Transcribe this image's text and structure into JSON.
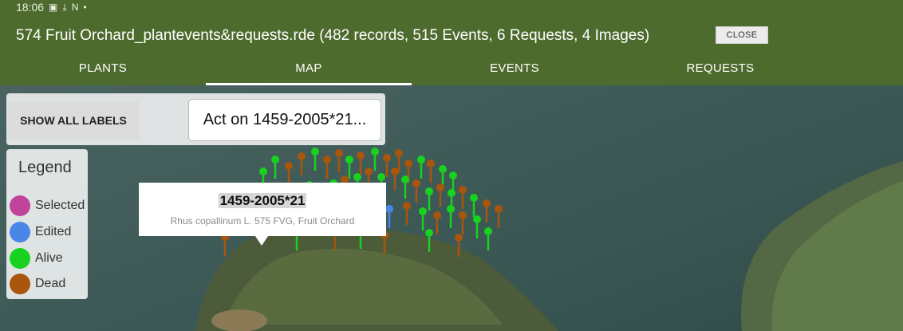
{
  "status_bar": {
    "time": "18:06",
    "icons": [
      "image-icon",
      "download-icon",
      "n-icon",
      "dot-icon"
    ]
  },
  "header": {
    "title": "574 Fruit Orchard_plantevents&requests.rde (482 records, 515 Events, 6 Requests, 4 Images)",
    "close_label": "CLOSE"
  },
  "tabs": [
    {
      "label": "PLANTS",
      "active": false
    },
    {
      "label": "MAP",
      "active": true
    },
    {
      "label": "EVENTS",
      "active": false
    },
    {
      "label": "REQUESTS",
      "active": false
    }
  ],
  "map_controls": {
    "show_all_labels": "SHOW ALL LABELS",
    "act_on": "Act on 1459-2005*21..."
  },
  "legend": {
    "title": "Legend",
    "items": [
      {
        "label": "Selected",
        "color": "#c0449b"
      },
      {
        "label": "Edited",
        "color": "#4a86e8"
      },
      {
        "label": "Alive",
        "color": "#18d21f"
      },
      {
        "label": "Dead",
        "color": "#a9550c"
      }
    ]
  },
  "popup": {
    "title": "1459-2005*21",
    "subtitle": "Rhus copallinum L. 575 FVG, Fruit Orchard"
  },
  "colors": {
    "header_bg": "#4e6b2e",
    "alive": "#18d21f",
    "dead": "#a9550c",
    "edited": "#4a86e8",
    "selected": "#c0449b"
  }
}
